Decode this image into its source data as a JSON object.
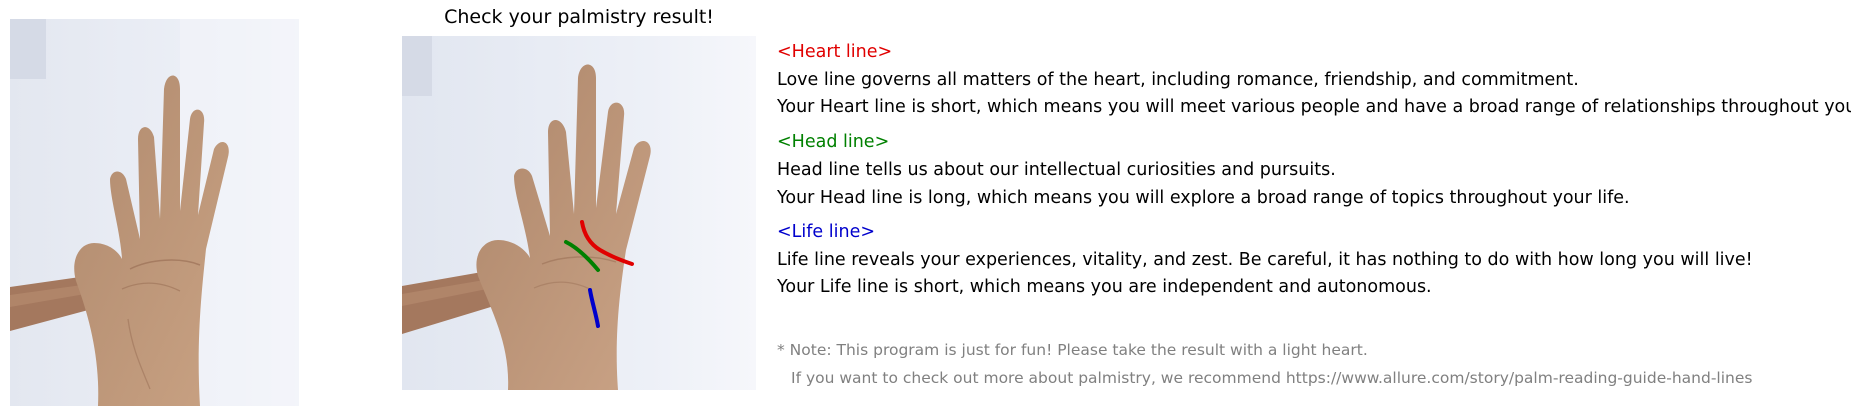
{
  "title": "Check your palmistry result!",
  "images": {
    "original": "palm-photo",
    "result": "palm-photo-with-traced-lines"
  },
  "colors": {
    "heart": "#e00000",
    "head": "#008000",
    "life": "#0000cc",
    "note": "#808080"
  },
  "sections": {
    "heart": {
      "heading": "<Heart line>",
      "description": "Love line governs all matters of the heart, including romance, friendship, and commitment.",
      "result": "Your Heart line is short, which means you will meet various people and have a broad range of relationships throughout your life."
    },
    "head": {
      "heading": "<Head line>",
      "description": "Head line tells us about our intellectual curiosities and pursuits.",
      "result": "Your Head line is long, which means you will explore a broad range of topics throughout your life."
    },
    "life": {
      "heading": "<Life line>",
      "description": "Life line reveals your experiences, vitality, and zest. Be careful, it has nothing to do with how long you will live!",
      "result": "Your Life line is short, which means you are independent and autonomous."
    }
  },
  "note": {
    "line1": "* Note: This program is just for fun! Please take the result with a light heart.",
    "line2": "If you want to check out more about palmistry, we recommend https://www.allure.com/story/palm-reading-guide-hand-lines"
  }
}
